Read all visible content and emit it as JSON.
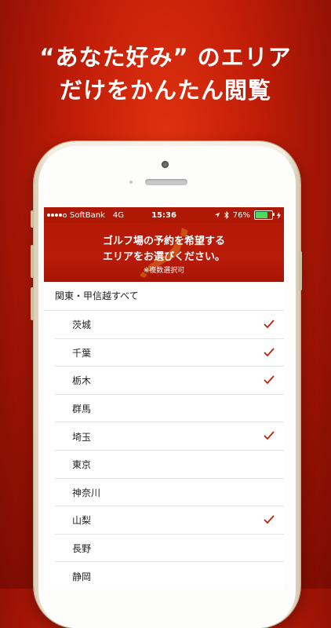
{
  "headline": {
    "line1": "“あなた好み” のエリア",
    "line2": "だけをかんたん閲覧"
  },
  "status_bar": {
    "carrier": "SoftBank",
    "network": "4G",
    "time": "15:36",
    "battery": "76%",
    "battery_level": 0.76
  },
  "banner": {
    "line1": "ゴルフ場の予約を希望する",
    "line2": "エリアをお選びください。",
    "note": "※複数選択可"
  },
  "list": {
    "group_label": "関東・甲信越すべて",
    "items": [
      {
        "label": "茨城",
        "checked": true
      },
      {
        "label": "千葉",
        "checked": true
      },
      {
        "label": "栃木",
        "checked": true
      },
      {
        "label": "群馬",
        "checked": false
      },
      {
        "label": "埼玉",
        "checked": true
      },
      {
        "label": "東京",
        "checked": false
      },
      {
        "label": "神奈川",
        "checked": false
      },
      {
        "label": "山梨",
        "checked": true
      },
      {
        "label": "長野",
        "checked": false
      },
      {
        "label": "静岡",
        "checked": false
      }
    ]
  },
  "colors": {
    "accent": "#b01806",
    "check": "#c41e0a",
    "background": "#c11d08"
  }
}
